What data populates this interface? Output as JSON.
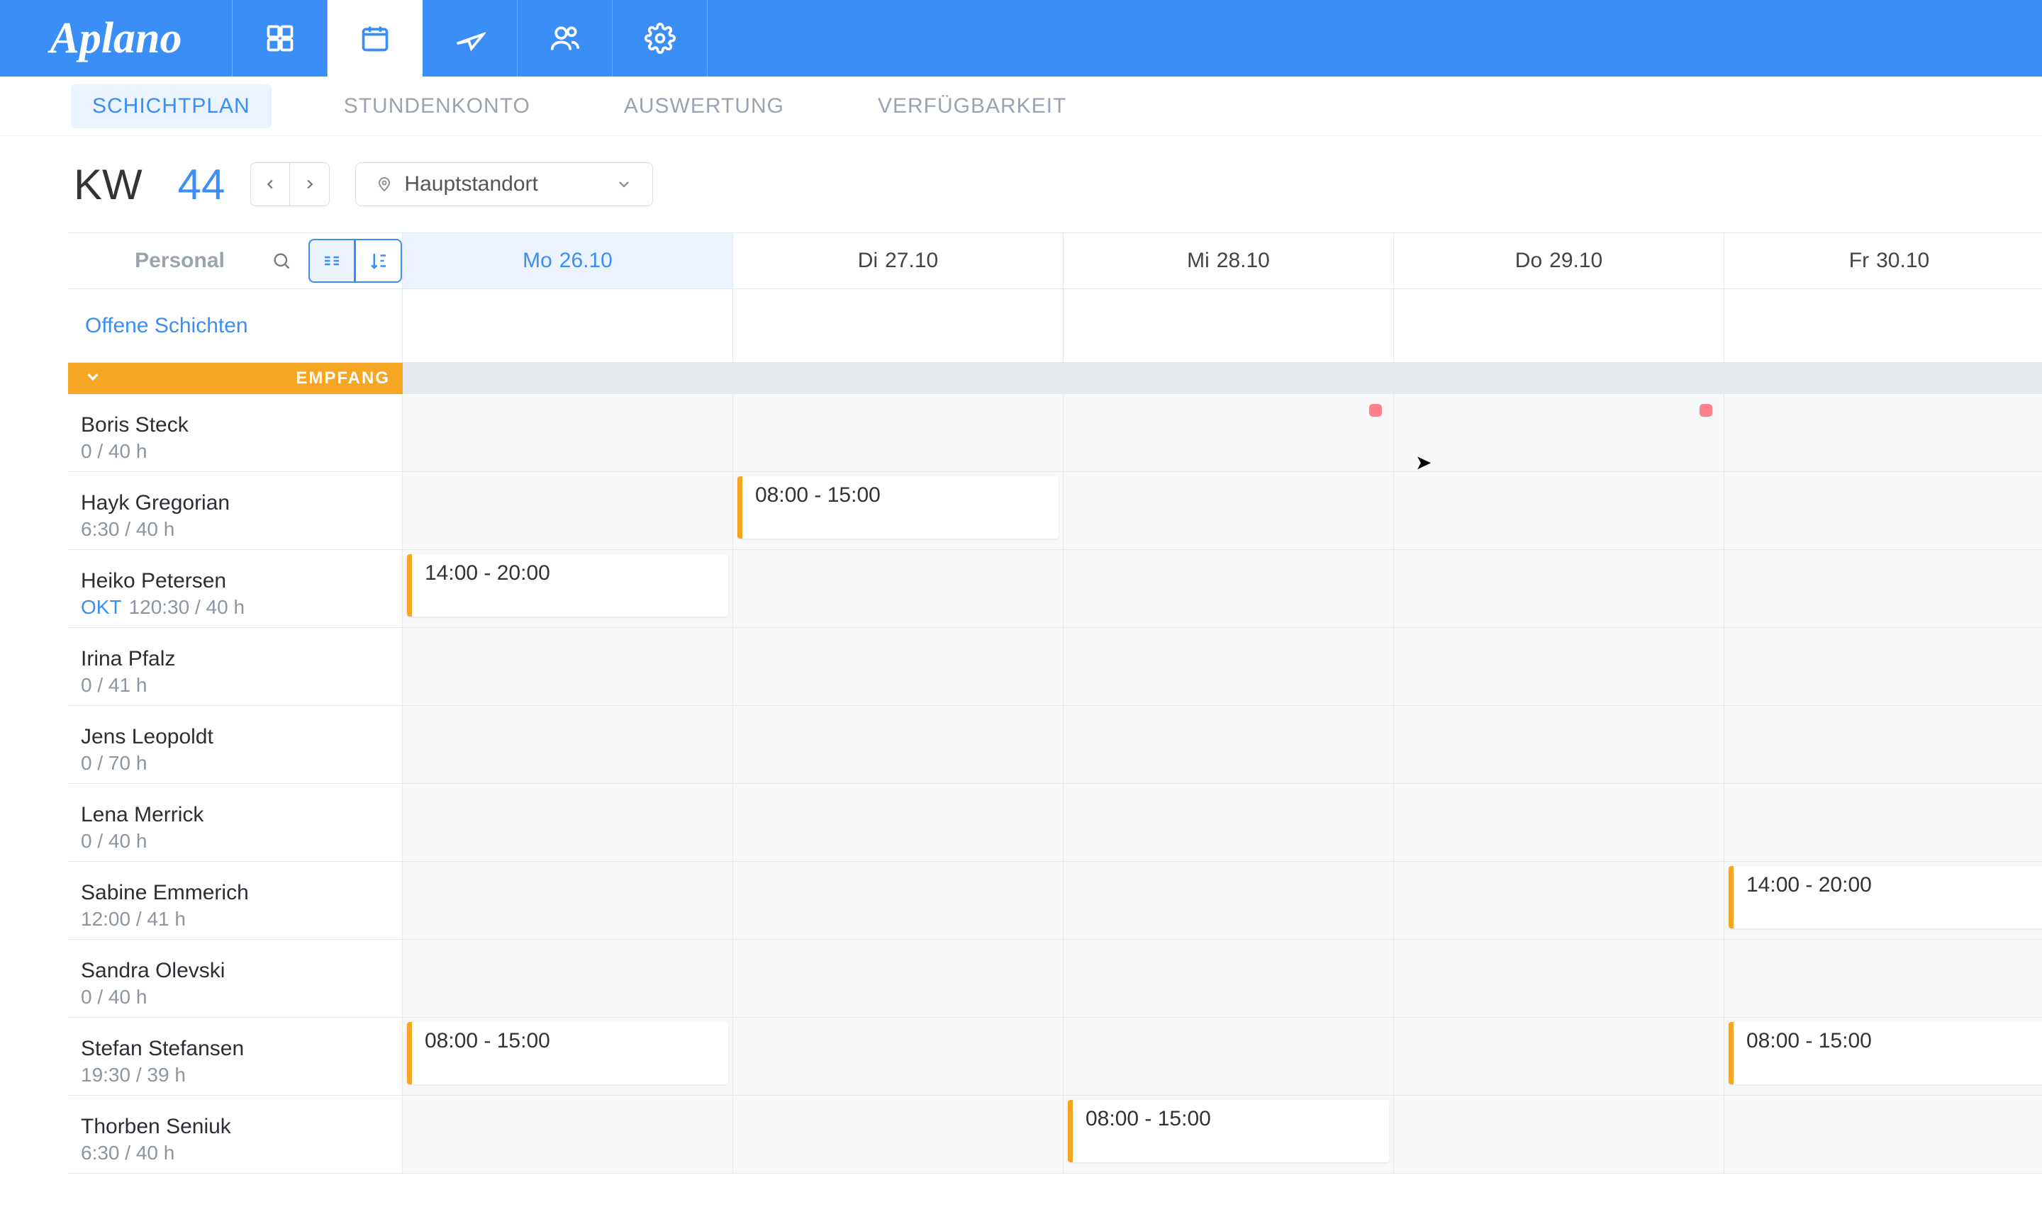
{
  "app": {
    "name": "Aplano"
  },
  "topnav": {
    "icons": [
      "dashboard",
      "calendar",
      "plane",
      "people",
      "settings"
    ],
    "active_index": 1
  },
  "subtabs": {
    "items": [
      "SCHICHTPLAN",
      "STUNDENKONTO",
      "AUSWERTUNG",
      "VERFÜGBARKEIT"
    ],
    "active_index": 0
  },
  "week": {
    "prefix": "KW",
    "number": "44"
  },
  "location": {
    "selected": "Hauptstandort"
  },
  "toolbar": {
    "search_placeholder": "Personal"
  },
  "days": [
    {
      "wd": "Mo",
      "date": "26.10",
      "active": true
    },
    {
      "wd": "Di",
      "date": "27.10",
      "active": false
    },
    {
      "wd": "Mi",
      "date": "28.10",
      "active": false
    },
    {
      "wd": "Do",
      "date": "29.10",
      "active": false
    },
    {
      "wd": "Fr",
      "date": "30.10",
      "active": false
    }
  ],
  "open_shifts_label": "Offene Schichten",
  "group": {
    "name": "EMPFANG"
  },
  "people": [
    {
      "name": "Boris Steck",
      "sub": "0 / 40 h",
      "tag": "",
      "marks": [
        2,
        3
      ]
    },
    {
      "name": "Hayk Gregorian",
      "sub": "6:30 / 40 h",
      "tag": "",
      "shifts": [
        {
          "day": 1,
          "label": "08:00 - 15:00"
        }
      ]
    },
    {
      "name": "Heiko Petersen",
      "sub": "120:30 / 40 h",
      "tag": "OKT",
      "shifts": [
        {
          "day": 0,
          "label": "14:00 - 20:00"
        }
      ]
    },
    {
      "name": "Irina Pfalz",
      "sub": "0 / 41 h",
      "tag": ""
    },
    {
      "name": "Jens Leopoldt",
      "sub": "0 / 70 h",
      "tag": ""
    },
    {
      "name": "Lena Merrick",
      "sub": "0 / 40 h",
      "tag": ""
    },
    {
      "name": "Sabine Emmerich",
      "sub": "12:00 / 41 h",
      "tag": "",
      "shifts": [
        {
          "day": 4,
          "label": "14:00 - 20:00"
        }
      ]
    },
    {
      "name": "Sandra Olevski",
      "sub": "0 / 40 h",
      "tag": ""
    },
    {
      "name": "Stefan Stefansen",
      "sub": "19:30 / 39 h",
      "tag": "",
      "shifts": [
        {
          "day": 0,
          "label": "08:00 - 15:00"
        },
        {
          "day": 4,
          "label": "08:00 - 15:00"
        }
      ]
    },
    {
      "name": "Thorben Seniuk",
      "sub": "6:30 / 40 h",
      "tag": "",
      "shifts": [
        {
          "day": 2,
          "label": "08:00 - 15:00"
        }
      ]
    }
  ]
}
